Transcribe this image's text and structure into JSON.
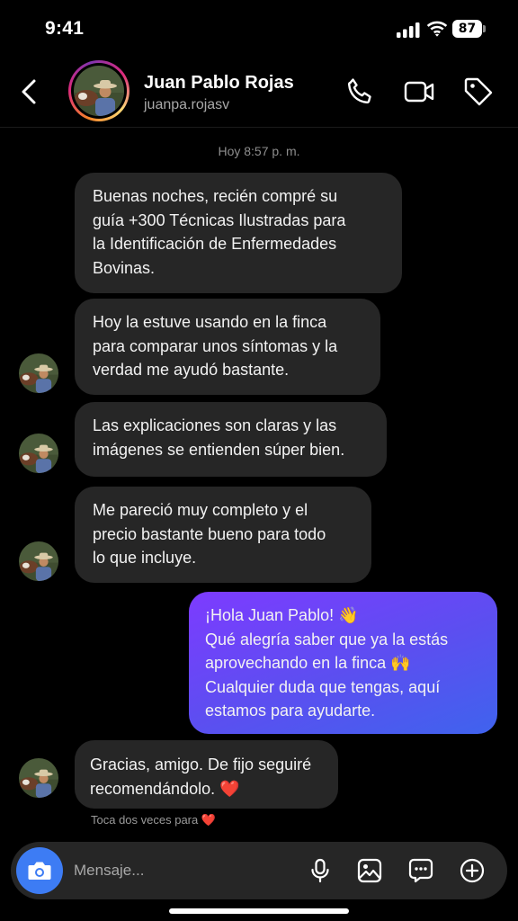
{
  "status_bar": {
    "time": "9:41",
    "battery": "87"
  },
  "header": {
    "name": "Juan Pablo Rojas",
    "username": "juanpa.rojasv"
  },
  "chat": {
    "timestamp": "Hoy 8:57 p. m.",
    "messages": [
      {
        "from": "contact",
        "lines": [
          "Buenas noches, recién compré su",
          "guía +300 Técnicas Ilustradas para",
          "la Identificación de Enfermedades",
          "Bovinas."
        ]
      },
      {
        "from": "contact",
        "lines": [
          "Hoy la estuve usando en la finca",
          "para comparar unos síntomas y la",
          "verdad me ayudó bastante."
        ]
      },
      {
        "from": "contact",
        "lines": [
          "Las explicaciones son claras y las",
          "imágenes se entienden súper bien."
        ]
      },
      {
        "from": "contact",
        "lines": [
          "Me pareció muy completo y el",
          "precio bastante bueno para todo",
          "lo que incluye."
        ]
      },
      {
        "from": "me",
        "lines": [
          "¡Hola Juan Pablo! 👋",
          "Qué alegría saber que ya la estás",
          "aprovechando en la finca 🙌",
          "Cualquier duda que tengas, aquí",
          "estamos para ayudarte."
        ]
      },
      {
        "from": "contact",
        "lines": [
          "Gracias, amigo. De fijo seguiré",
          "recomendándolo. ❤️"
        ]
      }
    ],
    "hint": "Toca dos veces para ❤️"
  },
  "composer": {
    "placeholder": "Mensaje..."
  },
  "colors": {
    "accent": "#3d7cf4",
    "bubble_in": "#262626",
    "bubble_out_start": "#7d3bff",
    "bubble_out_end": "#3f63ee"
  },
  "icons": [
    "back-icon",
    "phone-icon",
    "video-camera-icon",
    "tag-icon",
    "camera-icon",
    "microphone-icon",
    "gallery-icon",
    "sticker-icon",
    "plus-circle-icon"
  ]
}
